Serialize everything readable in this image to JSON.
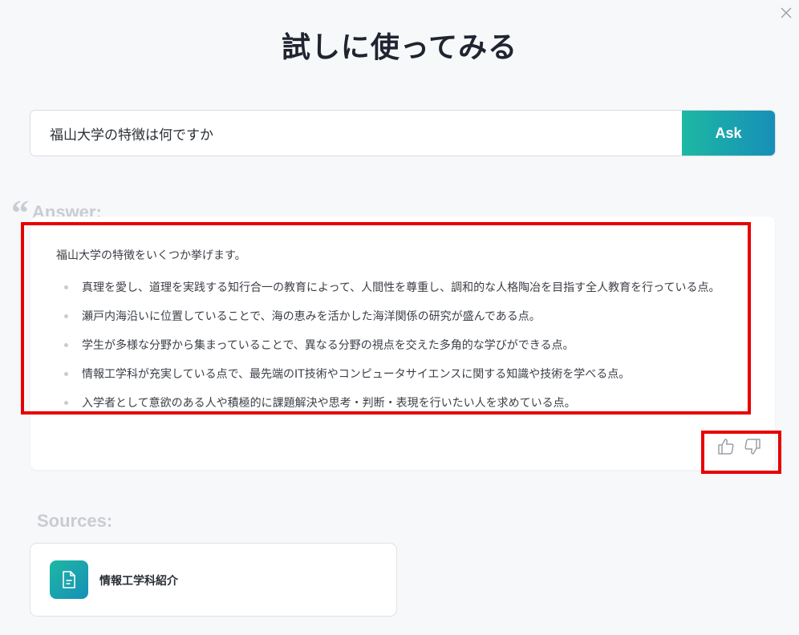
{
  "page": {
    "title": "試しに使ってみる"
  },
  "search": {
    "value": "福山大学の特徴は何ですか",
    "button_label": "Ask"
  },
  "answer": {
    "label": "Answer:",
    "intro": "福山大学の特徴をいくつか挙げます。",
    "items": [
      "真理を愛し、道理を実践する知行合一の教育によって、人間性を尊重し、調和的な人格陶冶を目指す全人教育を行っている点。",
      "瀬戸内海沿いに位置していることで、海の恵みを活かした海洋関係の研究が盛んである点。",
      "学生が多様な分野から集まっていることで、異なる分野の視点を交えた多角的な学びができる点。",
      "情報工学科が充実している点で、最先端のIT技術やコンピュータサイエンスに関する知識や技術を学べる点。",
      "入学者として意欲のある人や積極的に課題解決や思考・判断・表現を行いたい人を求めている点。"
    ]
  },
  "sources": {
    "label": "Sources:",
    "items": [
      {
        "title": "情報工学科紹介"
      }
    ]
  },
  "colors": {
    "accent_start": "#1db8a3",
    "accent_end": "#178fb8",
    "highlight": "#e80000"
  }
}
